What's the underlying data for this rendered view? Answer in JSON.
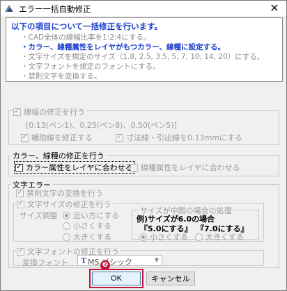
{
  "window": {
    "title": "エラー一括自動修正",
    "close_glyph": "✕"
  },
  "info": {
    "heading": "以下の項目について一括修正を行います。",
    "lines": [
      {
        "text": "・CAD全体の線幅比率を1:2:4にする。",
        "emphasis": false
      },
      {
        "text": "・カラー、線種属性をレイヤがもつカラー、線種に設定する。",
        "emphasis": true
      },
      {
        "text": "・文字サイズを規定のサイズ（1.8, 2.5, 3.5, 5, 7, 10, 14, 20）にする。",
        "emphasis": false
      },
      {
        "text": "・文字フォントを規定のフォントにする。",
        "emphasis": false
      },
      {
        "text": "・禁則文字を変換する。",
        "emphasis": false
      }
    ]
  },
  "linewidth": {
    "label": "線幅の修正を行う",
    "checked": true,
    "detail": "[0.13(ペン1)、0.25(ペン8)、0.50(ペン5)]",
    "auxiliary_label": "輔助線を修正する",
    "auxiliary_checked": true,
    "dimension_label": "寸法線・引出線を0.13mmにする",
    "dimension_checked": true
  },
  "color": {
    "group_label": "カラー、線種の修正を行う",
    "color_label": "カラー属性をレイヤに合わせる",
    "color_checked": true,
    "linetype_label": "線種属性をレイヤに合わせる",
    "linetype_checked": false
  },
  "text": {
    "group_label": "文字エラー",
    "forbidden_label": "禁則文字の変換を行う",
    "forbidden_checked": true,
    "size_label": "文字サイズの修正を行う",
    "size_checked": true,
    "adjust_label": "サイズ調整",
    "adjust_options": [
      "近い方にする",
      "小さくする",
      "大きくする"
    ],
    "adjust_selected": 0,
    "mid": {
      "group_label": "サイズが中間の場合の処理",
      "example": "例)サイズが6.0の場合",
      "small_case": "『5.0にする』",
      "large_case": "『7.0にする』",
      "options": [
        "小さくする",
        "大きくする"
      ],
      "selected": 0
    },
    "font_label": "文字フォントの修正を行う",
    "font_checked": true,
    "font_field_label": "変換フォント",
    "font_value": "MS ゴシック",
    "font_icon_text": "T"
  },
  "callout": {
    "number": "❷",
    "color": "#c0143c"
  },
  "buttons": {
    "ok": "OK",
    "cancel": "キャンセル"
  },
  "colors": {
    "accent": "#1c3fcc",
    "highlight": "#c0143c"
  }
}
